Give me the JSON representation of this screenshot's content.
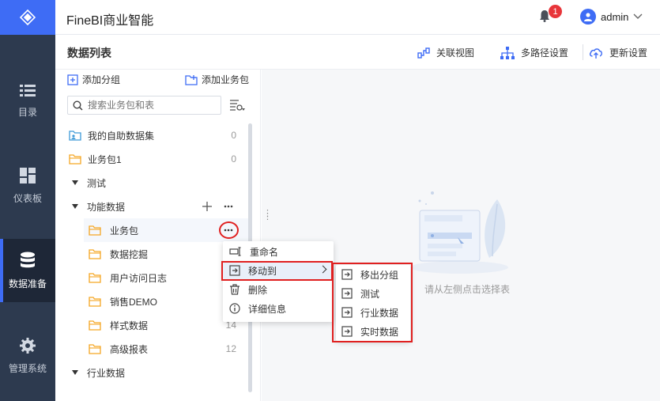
{
  "nav": {
    "items": [
      {
        "label": "目录",
        "icon": "list-icon"
      },
      {
        "label": "仪表板",
        "icon": "dashboard-icon"
      },
      {
        "label": "数据准备",
        "icon": "database-icon"
      },
      {
        "label": "管理系统",
        "icon": "gear-icon"
      }
    ],
    "active_index": 2
  },
  "header": {
    "title": "FineBI商业智能",
    "notification_count": "1",
    "user_name": "admin"
  },
  "subheader": {
    "title": "数据列表",
    "tools": [
      {
        "label": "关联视图",
        "icon": "relation-view-icon"
      },
      {
        "label": "多路径设置",
        "icon": "multipath-icon"
      },
      {
        "label": "更新设置",
        "icon": "cloud-update-icon"
      }
    ]
  },
  "left_panel": {
    "add_group_label": "添加分组",
    "add_package_label": "添加业务包",
    "search_placeholder": "搜索业务包和表",
    "tree": [
      {
        "label": "我的自助数据集",
        "count": "0",
        "type": "dataset"
      },
      {
        "label": "业务包1",
        "count": "0",
        "type": "folder"
      },
      {
        "label": "测试",
        "count": "",
        "type": "group"
      },
      {
        "label": "功能数据",
        "count": "",
        "type": "group"
      },
      {
        "label": "业务包",
        "count": "",
        "type": "folder"
      },
      {
        "label": "数据挖掘",
        "count": "",
        "type": "folder"
      },
      {
        "label": "用户访问日志",
        "count": "",
        "type": "folder"
      },
      {
        "label": "销售DEMO",
        "count": "",
        "type": "folder"
      },
      {
        "label": "样式数据",
        "count": "14",
        "type": "folder"
      },
      {
        "label": "高级报表",
        "count": "12",
        "type": "folder"
      },
      {
        "label": "行业数据",
        "count": "",
        "type": "group"
      }
    ]
  },
  "context_menu": {
    "items": [
      {
        "label": "重命名",
        "icon": "rename-icon"
      },
      {
        "label": "移动到",
        "icon": "move-to-icon"
      },
      {
        "label": "删除",
        "icon": "trash-icon"
      },
      {
        "label": "详细信息",
        "icon": "info-icon"
      }
    ]
  },
  "submenu": {
    "items": [
      {
        "label": "移出分组"
      },
      {
        "label": "测试"
      },
      {
        "label": "行业数据"
      },
      {
        "label": "实时数据"
      }
    ]
  },
  "empty_state": {
    "text": "请从左侧点击选择表"
  },
  "colors": {
    "accent": "#3e6cf5",
    "nav_bg": "#2d3a4f",
    "folder": "#f5a623",
    "highlight_red": "#e02020",
    "badge": "#e8353a"
  }
}
